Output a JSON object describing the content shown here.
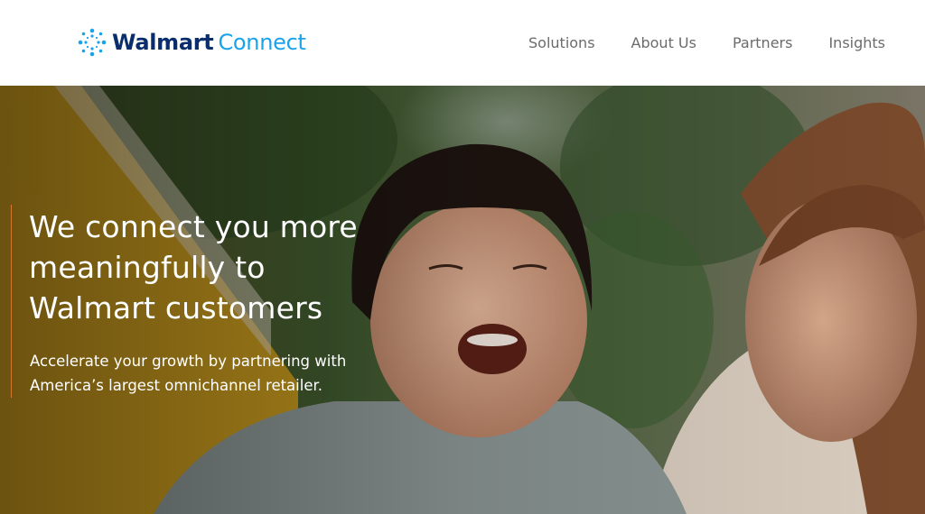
{
  "header": {
    "logo_brand": "Walmart",
    "logo_product": "Connect",
    "nav": [
      {
        "label": "Solutions"
      },
      {
        "label": "About Us"
      },
      {
        "label": "Partners"
      },
      {
        "label": "Insights"
      }
    ]
  },
  "hero": {
    "title_line1": "We connect you more",
    "title_line2": "meaningfully to",
    "title_line3": "Walmart customers",
    "subtitle_line1": "Accelerate your growth by partnering with",
    "subtitle_line2": "America’s largest omnichannel retailer."
  },
  "colors": {
    "brand_navy": "#0a2d6b",
    "brand_blue": "#1aa3e8",
    "accent_orange": "#d27a2c",
    "nav_text": "#6b6b6b"
  },
  "icons": {
    "logo": "spark-icon"
  }
}
